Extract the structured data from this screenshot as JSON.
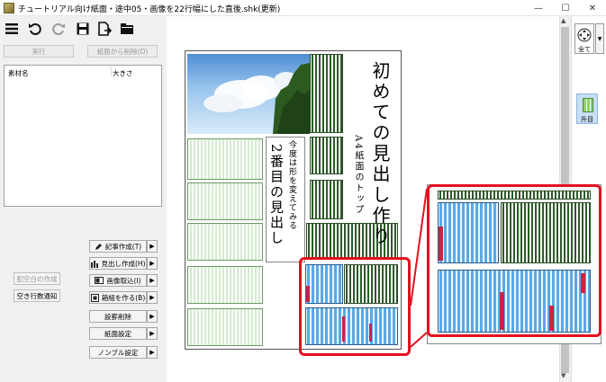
{
  "window": {
    "title": "チュートリアル向け紙面・途中05・画像を22行幅にした直後.shk(更新)",
    "minimize": "—",
    "maximize": "☐",
    "close": "✕"
  },
  "toolbar": {
    "icons": [
      "menu-icon",
      "undo-icon",
      "redo-icon",
      "save-icon",
      "export-icon",
      "open-folder-icon"
    ]
  },
  "left_panel": {
    "run_label": "実行",
    "delete_from_page_label": "紙面から削除(D)",
    "list_headers": {
      "material_name": "素材名",
      "size": "大きさ"
    },
    "function_buttons": [
      {
        "label": "記事作成(T)",
        "icon": "pencil-icon"
      },
      {
        "label": "見出し作成(H)",
        "icon": "headline-icon"
      },
      {
        "label": "画像取込(I)",
        "icon": "image-icon"
      },
      {
        "label": "箱組を作る(B)",
        "icon": "box-icon"
      },
      {
        "label": "設罫削除",
        "icon": ""
      },
      {
        "label": "紙面設定",
        "icon": ""
      },
      {
        "label": "ノンブル設定",
        "icon": ""
      }
    ],
    "blank_create_label": "配空白の作成",
    "blank_notify_label": "空き行数通知"
  },
  "page_content": {
    "headline": "初めての見出し作り",
    "subhead": "A4紙面のトップ",
    "second_headline": "2番目の見出し",
    "second_subhead": "今度は形を変えてみる"
  },
  "right_panel": {
    "fit_label": "全て",
    "spread_label": "升目"
  }
}
